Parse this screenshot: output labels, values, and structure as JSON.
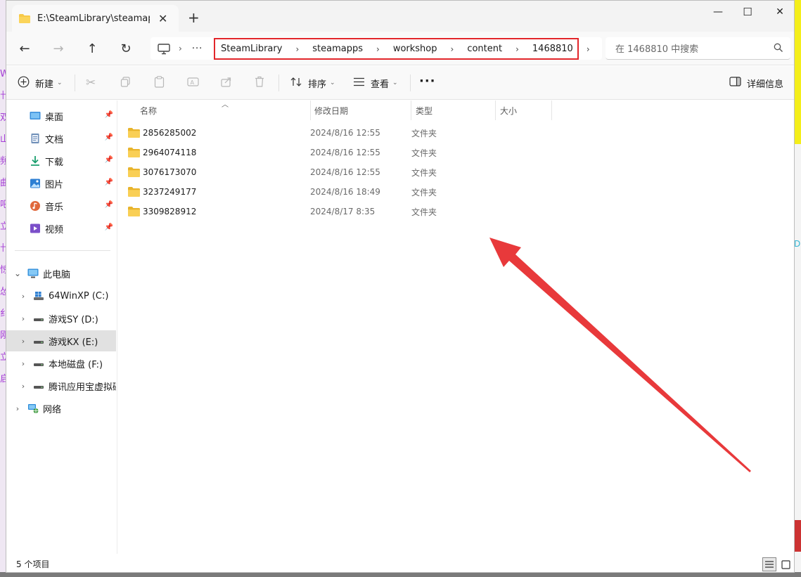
{
  "background": {
    "left_chars": "W卄双山频曲吧立卄惊怂纟刚立启",
    "right_chars": "Dr"
  },
  "window": {
    "tab": {
      "title": "E:\\SteamLibrary\\steamapps\\wo",
      "icon": "folder-icon",
      "close_label": "✕"
    },
    "new_tab_label": "+",
    "controls": {
      "minimize": "—",
      "maximize": "☐",
      "close": "✕"
    }
  },
  "nav": {
    "back": "←",
    "forward": "→",
    "up": "↑",
    "refresh": "↻",
    "more_label": "···",
    "breadcrumbs": [
      "SteamLibrary",
      "steamapps",
      "workshop",
      "content",
      "1468810"
    ],
    "search_placeholder": "在 1468810 中搜索"
  },
  "commands": {
    "new_label": "新建",
    "sort_label": "排序",
    "view_label": "查看",
    "more_label": "···",
    "details_label": "详细信息"
  },
  "sidebar": {
    "quick_access": [
      {
        "label": "桌面",
        "icon": "desktop-icon"
      },
      {
        "label": "文档",
        "icon": "documents-icon"
      },
      {
        "label": "下载",
        "icon": "downloads-icon"
      },
      {
        "label": "图片",
        "icon": "pictures-icon"
      },
      {
        "label": "音乐",
        "icon": "music-icon"
      },
      {
        "label": "视频",
        "icon": "videos-icon"
      }
    ],
    "this_pc": "此电脑",
    "drives": [
      {
        "label": "64WinXP  (C:)"
      },
      {
        "label": "游戏SY (D:)"
      },
      {
        "label": "游戏KX (E:)"
      },
      {
        "label": "本地磁盘 (F:)"
      },
      {
        "label": "腾讯应用宝虚拟磁"
      }
    ],
    "network": "网络"
  },
  "columns": {
    "name": "名称",
    "date": "修改日期",
    "type": "类型",
    "size": "大小"
  },
  "files": [
    {
      "name": "2856285002",
      "date": "2024/8/16 12:55",
      "type": "文件夹"
    },
    {
      "name": "2964074118",
      "date": "2024/8/16 12:55",
      "type": "文件夹"
    },
    {
      "name": "3076173070",
      "date": "2024/8/16 12:55",
      "type": "文件夹"
    },
    {
      "name": "3237249177",
      "date": "2024/8/16 18:49",
      "type": "文件夹"
    },
    {
      "name": "3309828912",
      "date": "2024/8/17 8:35",
      "type": "文件夹"
    }
  ],
  "status": {
    "item_count": "5 个项目"
  },
  "colors": {
    "highlight_box": "#e2262b",
    "annotation_arrow": "#e8393b",
    "folder": "#f7c948"
  }
}
